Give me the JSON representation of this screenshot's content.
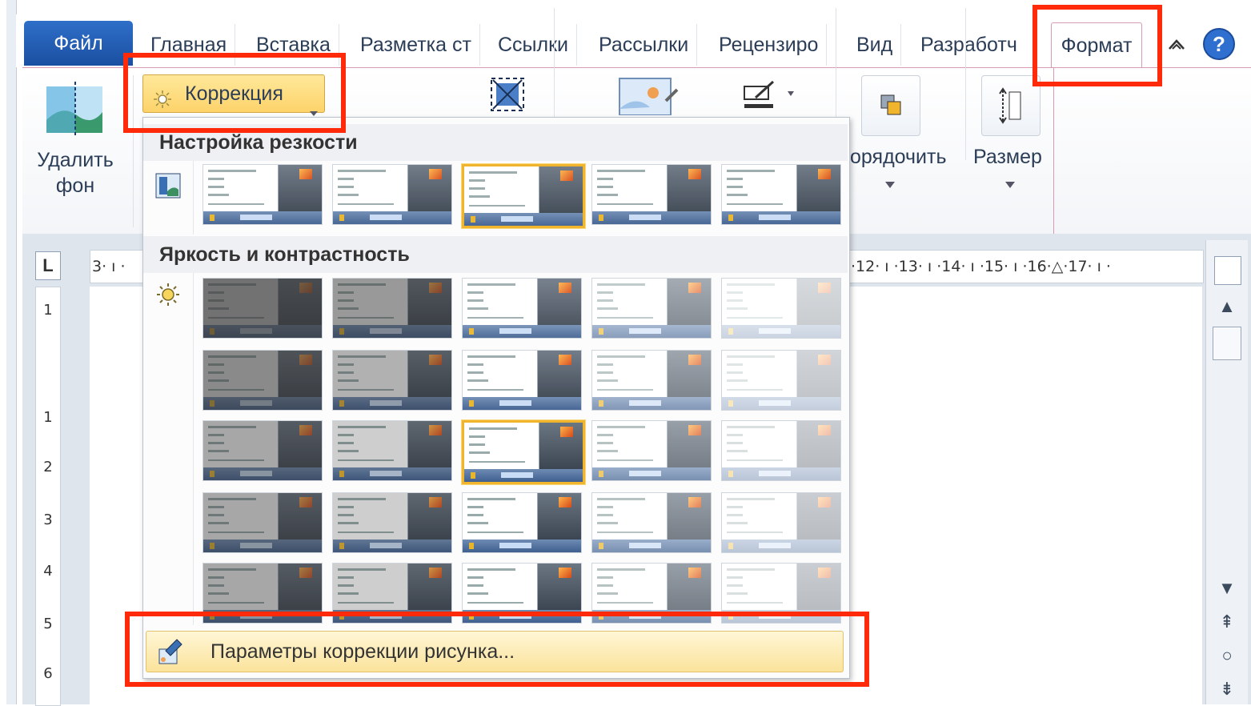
{
  "tabs": {
    "file": "Файл",
    "home": "Главная",
    "insert": "Вставка",
    "layout": "Разметка ст",
    "references": "Ссылки",
    "mailings": "Рассылки",
    "review": "Рецензиро",
    "view": "Вид",
    "developer": "Разработч",
    "format": "Формат"
  },
  "ribbon": {
    "remove_bg_line1": "Удалить",
    "remove_bg_line2": "фон",
    "correction_label": "Коррекция",
    "arrange_label": "орядочить",
    "size_label": "Размер"
  },
  "dropdown": {
    "sharpness_header": "Настройка резкости",
    "brightness_header": "Яркость и контрастность",
    "footer_label": "Параметры коррекции рисунка...",
    "sharpness_selected_index": 2,
    "brightness_selected": [
      2,
      2
    ]
  },
  "rulers": {
    "corner": "L",
    "horizontal_left": "3· ı ·",
    "horizontal_right": "·12· ı ·13· ı ·14· ı ·15· ı ·16·△·17· ı ·",
    "vertical_numbers": [
      "1",
      "1",
      "2",
      "3",
      "4",
      "5",
      "6"
    ]
  },
  "colors": {
    "highlight": "#ff2a0a",
    "file_tab": "#2f6fc9",
    "selected_thumb_border": "#f0b52c",
    "footer_bg": "#fbe39b"
  },
  "icons": {
    "minimize_ribbon": "chevron-up-icon",
    "help": "help-icon",
    "sun": "sun-icon",
    "sharpness": "sharpness-icon"
  }
}
